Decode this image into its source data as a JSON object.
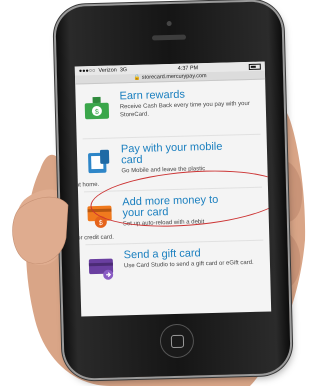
{
  "status": {
    "carrier": "Verizon",
    "network": "3G",
    "time": "4:37 PM"
  },
  "url": "storecard.mercurypay.com",
  "items": [
    {
      "title": "Earn rewards",
      "desc": "Receive Cash Back every time you pay with your StoreCard.",
      "desc_tail": "",
      "icon": "cash-reward-icon",
      "accent": "#3aa64a"
    },
    {
      "title_l1": "Pay with your mobile",
      "title_l2": "card",
      "desc": "Go Mobile and leave the plastic",
      "desc_tail": "at home.",
      "icon": "mobile-payment-icon",
      "accent": "#2e86c8"
    },
    {
      "title_l1": "Add more money to",
      "title_l2": "your card",
      "desc": "Set up auto-reload with a debit",
      "desc_tail": "or credit card.",
      "icon": "reload-card-icon",
      "accent": "#f07a1e"
    },
    {
      "title": "Send a gift card",
      "desc": "Use Card Studio to send a gift card or eGift card.",
      "desc_tail": "",
      "icon": "gift-card-icon",
      "accent": "#6a3fa0"
    }
  ],
  "colors": {
    "title": "#1a7fbf",
    "highlight": "#cc3333"
  }
}
